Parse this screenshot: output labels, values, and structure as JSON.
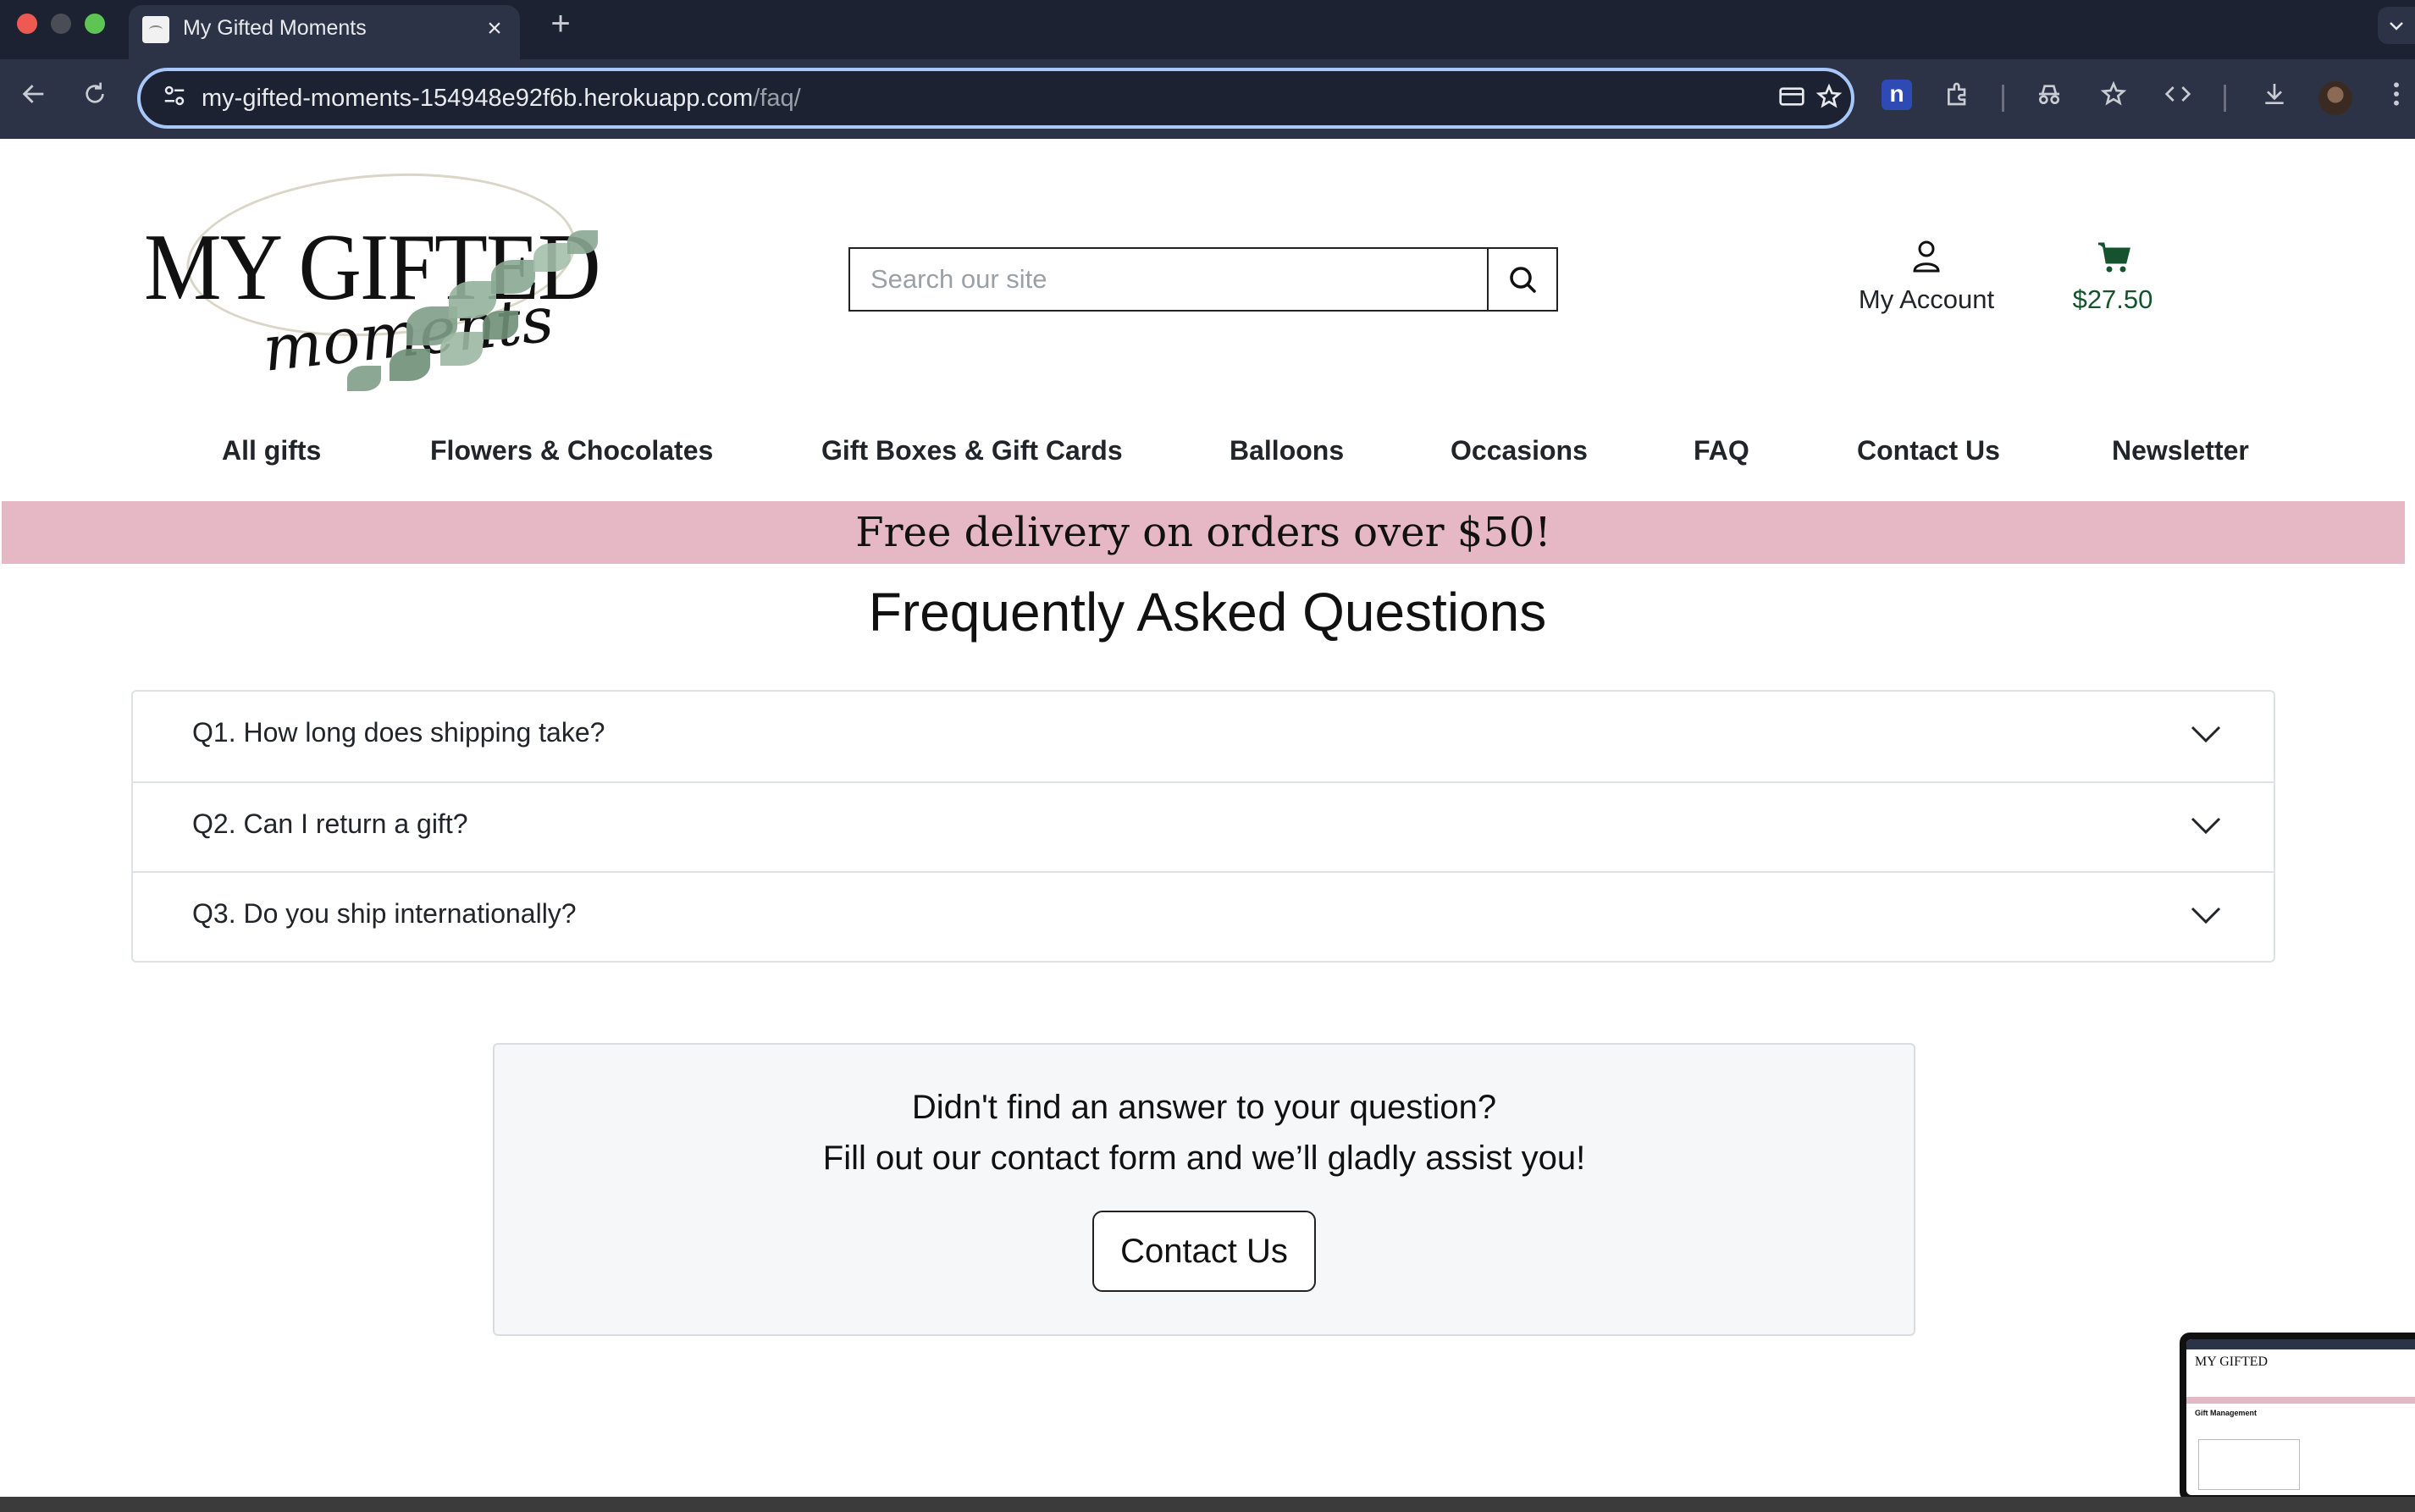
{
  "browser": {
    "tab_title": "My Gifted Moments",
    "tab_close": "×",
    "new_tab": "+",
    "url_host": "my-gifted-moments-154948e92f6b.herokuapp.com",
    "url_path": "/faq/",
    "extension_label": "n"
  },
  "header": {
    "logo_main": "MY GIFTED",
    "logo_sub": "moments",
    "search_placeholder": "Search our site",
    "account_label": "My Account",
    "cart_total": "$27.50"
  },
  "nav": {
    "items": [
      {
        "label": "All gifts"
      },
      {
        "label": "Flowers & Chocolates"
      },
      {
        "label": "Gift Boxes & Gift Cards"
      },
      {
        "label": "Balloons"
      },
      {
        "label": "Occasions"
      },
      {
        "label": "FAQ"
      },
      {
        "label": "Contact Us"
      },
      {
        "label": "Newsletter"
      }
    ]
  },
  "banner": {
    "text": "Free delivery on orders over $50!",
    "color": "#e6b8c6"
  },
  "faq": {
    "title": "Frequently Asked Questions",
    "questions": [
      {
        "text": "Q1. How long does shipping take?"
      },
      {
        "text": "Q2. Can I return a gift?"
      },
      {
        "text": "Q3. Do you ship internationally?"
      }
    ]
  },
  "help": {
    "line1": "Didn't find an answer to your question?",
    "line2": "Fill out our contact form and we’ll gladly assist you!",
    "button_label": "Contact Us"
  },
  "thumbnail": {
    "logo_text": "MY GIFTED",
    "heading": "Gift Management"
  },
  "colors": {
    "accent_cart": "#14532d",
    "focus_ring": "#a8c7fa",
    "chrome_dark": "#1c2231"
  }
}
